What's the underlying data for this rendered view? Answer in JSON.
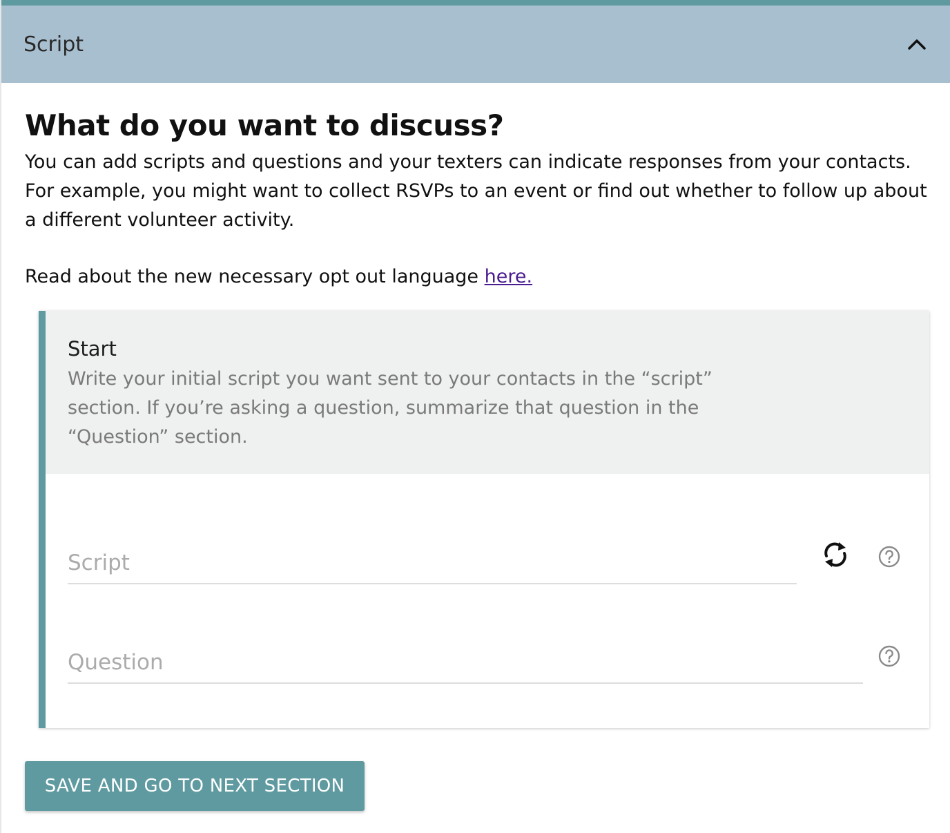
{
  "section": {
    "title": "Script",
    "collapse_icon": "chevron-up-icon",
    "accent_color": "#5f9aa0",
    "header_color": "#a8bfcf"
  },
  "main": {
    "heading": "What do you want to discuss?",
    "intro": "You can add scripts and questions and your texters can indicate responses from your contacts. For example, you might want to collect RSVPs to an event or find out whether to follow up about a different volunteer activity.",
    "optout_text": "Read about the new necessary opt out language ",
    "optout_link": "here."
  },
  "card": {
    "title": "Start",
    "description": "Write your initial script you want sent to your contacts in the “script” section. If you’re asking a question, summarize that question in the “Question” section.",
    "script_placeholder": "Script",
    "question_placeholder": "Question",
    "sync_icon": "sync-icon",
    "help_icon": "help-circle-icon"
  },
  "actions": {
    "save_label": "SAVE AND GO TO NEXT SECTION"
  }
}
